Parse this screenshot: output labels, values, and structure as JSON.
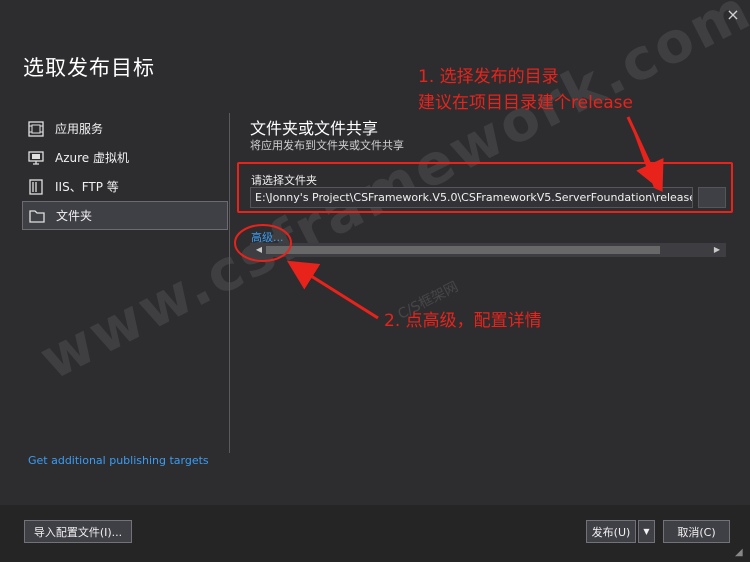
{
  "dialog": {
    "close_icon": "×",
    "title": "选取发布目标"
  },
  "nav": {
    "items": [
      {
        "label": "应用服务",
        "icon": "app-service-icon"
      },
      {
        "label": "Azure 虚拟机",
        "icon": "virtual-machine-icon"
      },
      {
        "label": "IIS、FTP 等",
        "icon": "iis-icon"
      },
      {
        "label": "文件夹",
        "icon": "folder-icon",
        "selected": true
      }
    ],
    "more_link": "Get additional publishing targets"
  },
  "main": {
    "section_title": "文件夹或文件共享",
    "section_subtitle": "将应用发布到文件夹或文件共享",
    "folder_label": "请选择文件夹",
    "folder_path": "E:\\Jonny's Project\\CSFramework.V5.0\\CSFrameworkV5.ServerFoundation\\release",
    "advanced_link": "高级...",
    "scroll_left": "◀",
    "scroll_right": "▶"
  },
  "footer": {
    "import_label": "导入配置文件(I)...",
    "publish_label": "发布(U)",
    "publish_dropdown": "▼",
    "cancel_label": "取消(C)"
  },
  "annotations": {
    "note1_line1": "1. 选择发布的目录",
    "note1_line2": "建议在项目目录建个release",
    "note2": "2. 点高级，配置详情",
    "color": "#e8231b"
  },
  "watermark": {
    "text": "www.csframework.com",
    "sub": "C/S框架网"
  },
  "colors": {
    "background": "#2d2d30",
    "footer": "#252526",
    "link": "#3b9cf2",
    "accent": "#e8231b"
  }
}
